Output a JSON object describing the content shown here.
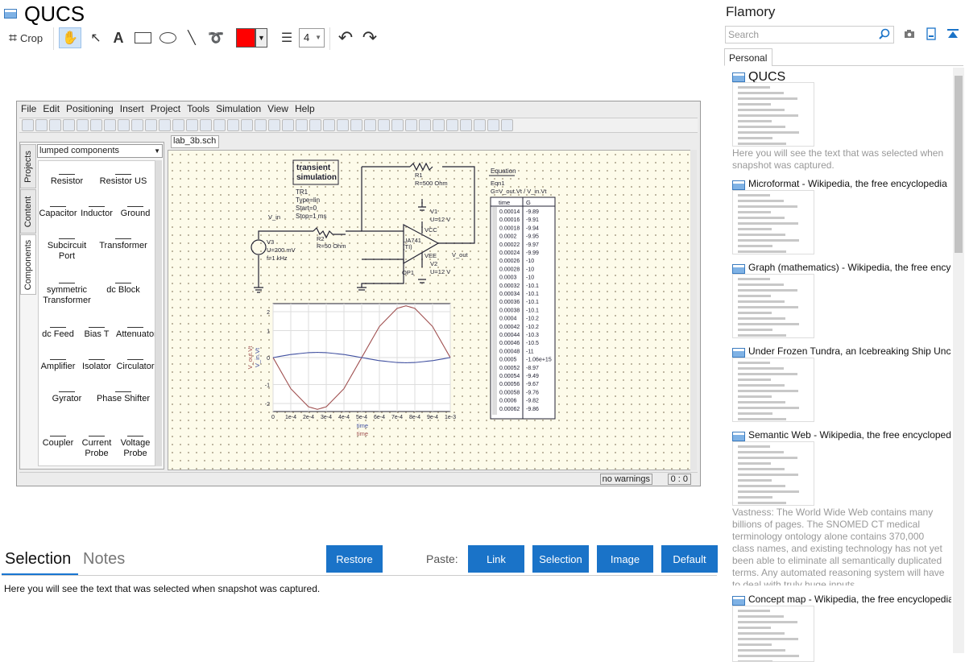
{
  "app": {
    "title": "QUCS"
  },
  "toolbar": {
    "crop_label": "Crop",
    "text_tool": "A",
    "line_width": "4"
  },
  "colors": {
    "accent": "#1a73c8",
    "pen": "#ff0000",
    "canvas": "#fdfbea",
    "plot_vout": "#a05050",
    "plot_vin": "#4050a0"
  },
  "snapshot": {
    "menu": [
      "File",
      "Edit",
      "Positioning",
      "Insert",
      "Project",
      "Tools",
      "Simulation",
      "View",
      "Help"
    ],
    "side_tabs": [
      "Projects",
      "Content",
      "Components"
    ],
    "component_category": "lumped components",
    "components": [
      [
        "Resistor",
        "Resistor US"
      ],
      [
        "Capacitor",
        "Inductor",
        "Ground"
      ],
      [
        "Subcircuit Port",
        "Transformer"
      ],
      [
        "symmetric Transformer",
        "dc Block"
      ],
      [
        "dc Feed",
        "Bias T",
        "Attenuator"
      ],
      [
        "Amplifier",
        "Isolator",
        "Circulator"
      ],
      [
        "Gyrator",
        "Phase Shifter"
      ],
      [
        "Coupler",
        "Current Probe",
        "Voltage Probe"
      ]
    ],
    "doc_tab": "lab_3b.sch",
    "schematic": {
      "sim_title_1": "transient",
      "sim_title_2": "simulation",
      "sim_params": [
        "TR1",
        "Type=lin",
        "Start=0",
        "Stop=1 ms"
      ],
      "r1": [
        "R1",
        "R=500 Ohm"
      ],
      "r2": [
        "R2",
        "R=50 Ohm"
      ],
      "v3": [
        "V3",
        "U=200 mV",
        "f=1 kHz"
      ],
      "v1": [
        "V1",
        "U=12 V"
      ],
      "v2": [
        "V2",
        "U=12 V"
      ],
      "opamp": [
        "UA741",
        "(TI)",
        "VCC",
        "VEE",
        "OP1"
      ],
      "v_in": "V_in",
      "v_out": "V_out",
      "equation": [
        "Equation",
        "Eqn1",
        "G=V_out.Vt / V_in.Vt"
      ]
    },
    "table": {
      "headers": [
        "time",
        "G"
      ],
      "rows": [
        [
          "0.00014",
          "-9.89"
        ],
        [
          "0.00016",
          "-9.91"
        ],
        [
          "0.00018",
          "-9.94"
        ],
        [
          "0.0002",
          "-9.95"
        ],
        [
          "0.00022",
          "-9.97"
        ],
        [
          "0.00024",
          "-9.99"
        ],
        [
          "0.00026",
          "-10"
        ],
        [
          "0.00028",
          "-10"
        ],
        [
          "0.0003",
          "-10"
        ],
        [
          "0.00032",
          "-10.1"
        ],
        [
          "0.00034",
          "-10.1"
        ],
        [
          "0.00036",
          "-10.1"
        ],
        [
          "0.00038",
          "-10.1"
        ],
        [
          "0.0004",
          "-10.2"
        ],
        [
          "0.00042",
          "-10.2"
        ],
        [
          "0.00044",
          "-10.3"
        ],
        [
          "0.00046",
          "-10.5"
        ],
        [
          "0.00048",
          "-11"
        ],
        [
          "0.0005",
          "-1.06e+15"
        ],
        [
          "0.00052",
          "-8.97"
        ],
        [
          "0.00054",
          "-9.49"
        ],
        [
          "0.00056",
          "-9.67"
        ],
        [
          "0.00058",
          "-9.76"
        ],
        [
          "0.0006",
          "-9.82"
        ],
        [
          "0.00062",
          "-9.86"
        ]
      ]
    },
    "status": {
      "warnings": "no warnings",
      "coords": "0 : 0"
    }
  },
  "chart_data": {
    "type": "line",
    "title": "",
    "xlabel": "time",
    "ylabel": "V_out.Vt / V_in.Vt",
    "y_axis_labels": [
      "V_out.Vt",
      "V_in.Vt"
    ],
    "x_axis_labels": [
      "time",
      "time"
    ],
    "xlim": [
      0,
      0.001
    ],
    "ylim": [
      -2,
      2
    ],
    "x_ticks": [
      "0",
      "1e-4",
      "2e-4",
      "3e-4",
      "4e-4",
      "5e-4",
      "6e-4",
      "7e-4",
      "8e-4",
      "9e-4",
      "1e-3"
    ],
    "y_ticks": [
      "2",
      "1",
      "0",
      "-1",
      "-2"
    ],
    "grid": true,
    "series": [
      {
        "name": "V_out.Vt",
        "color": "#a05050",
        "x": [
          0,
          0.0001,
          0.0002,
          0.00025,
          0.0003,
          0.0004,
          0.0005,
          0.0006,
          0.0007,
          0.00075,
          0.0008,
          0.0009,
          0.001
        ],
        "y": [
          0,
          -1.2,
          -1.9,
          -2.0,
          -1.9,
          -1.2,
          0,
          1.2,
          1.9,
          2.0,
          1.9,
          1.2,
          0
        ]
      },
      {
        "name": "V_in.Vt",
        "color": "#4050a0",
        "x": [
          0,
          0.0001,
          0.0002,
          0.00025,
          0.0003,
          0.0004,
          0.0005,
          0.0006,
          0.0007,
          0.00075,
          0.0008,
          0.0009,
          0.001
        ],
        "y": [
          0,
          0.12,
          0.19,
          0.2,
          0.19,
          0.12,
          0,
          -0.12,
          -0.19,
          -0.2,
          -0.19,
          -0.12,
          0
        ]
      }
    ]
  },
  "bottom": {
    "tabs": [
      "Selection",
      "Notes"
    ],
    "restore": "Restore",
    "paste_label": "Paste:",
    "paste_buttons": [
      "Link",
      "Selection",
      "Image",
      "Default"
    ],
    "selection_text": "Here you will see the text that was selected when snapshot was captured."
  },
  "right_panel": {
    "title": "Flamory",
    "search_placeholder": "Search",
    "tab": "Personal",
    "items": [
      {
        "title": "QUCS",
        "desc": "Here you will see the text that was selected when snapshot was captured."
      },
      {
        "title": "Microformat - Wikipedia, the free encyclopedia"
      },
      {
        "title": "Graph (mathematics) - Wikipedia, the free encyclopedia"
      },
      {
        "title": "Under Frozen Tundra, an Icebreaking Ship Uncovers"
      },
      {
        "title": "Semantic Web - Wikipedia, the free encyclopedia",
        "desc": "Vastness: The World Wide Web contains many billions of pages. The SNOMED CT medical terminology ontology alone contains 370,000 class names, and existing technology has not yet been able to eliminate all semantically duplicated terms. Any automated reasoning system will have to deal with truly huge inputs."
      },
      {
        "title": "Concept map - Wikipedia, the free encyclopedia"
      }
    ]
  }
}
